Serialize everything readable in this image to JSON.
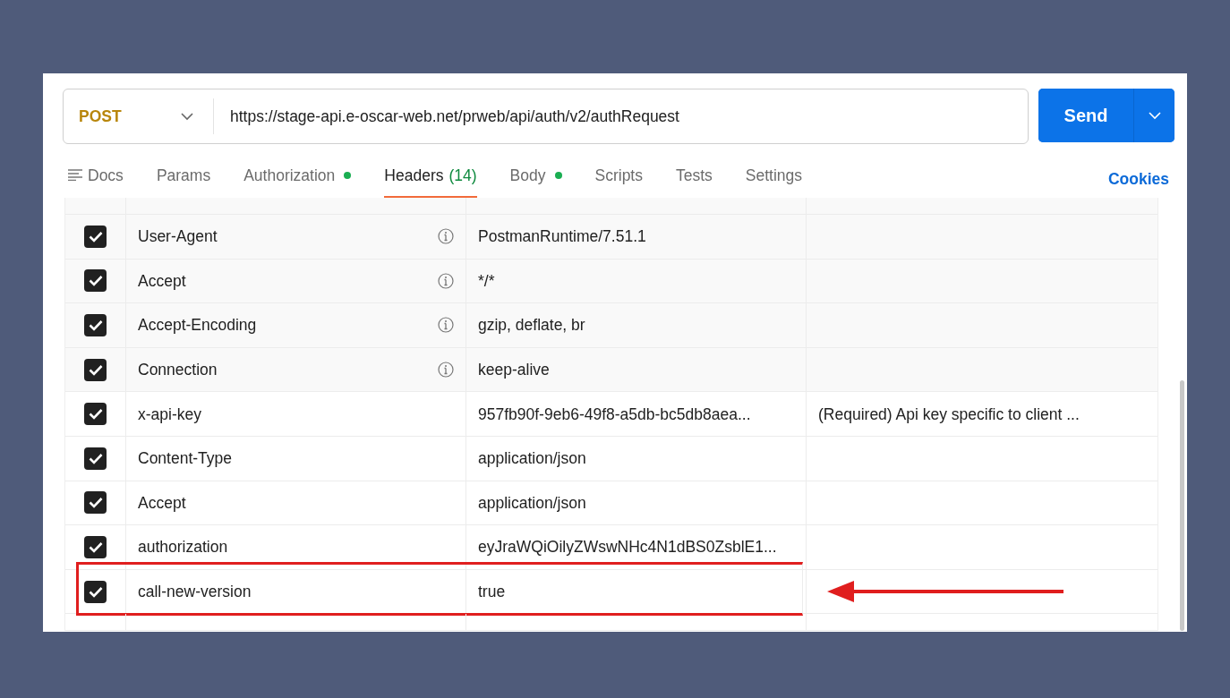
{
  "request": {
    "method": "POST",
    "url": "https://stage-api.e-oscar-web.net/prweb/api/auth/v2/authRequest",
    "send_label": "Send"
  },
  "tabs": [
    {
      "label": "Docs",
      "dot": false,
      "selected": false,
      "kind": "docs"
    },
    {
      "label": "Params",
      "dot": false,
      "selected": false,
      "kind": "plain"
    },
    {
      "label": "Authorization",
      "dot": true,
      "selected": false,
      "kind": "plain"
    },
    {
      "label": "Headers",
      "count": "(14)",
      "dot": false,
      "selected": true,
      "kind": "plain"
    },
    {
      "label": "Body",
      "dot": true,
      "selected": false,
      "kind": "plain"
    },
    {
      "label": "Scripts",
      "dot": false,
      "selected": false,
      "kind": "plain"
    },
    {
      "label": "Tests",
      "dot": false,
      "selected": false,
      "kind": "plain"
    },
    {
      "label": "Settings",
      "dot": false,
      "selected": false,
      "kind": "plain"
    }
  ],
  "cookies_link": "Cookies",
  "headers": [
    {
      "key": "User-Agent",
      "value": "PostmanRuntime/7.51.1",
      "checked": true,
      "kind": "auto",
      "highlighted": false
    },
    {
      "key": "Accept",
      "value": "*/*",
      "checked": true,
      "kind": "auto",
      "highlighted": false
    },
    {
      "key": "Accept-Encoding",
      "value": "gzip, deflate, br",
      "checked": true,
      "kind": "auto",
      "highlighted": false
    },
    {
      "key": "Connection",
      "value": "keep-alive",
      "checked": true,
      "kind": "auto",
      "highlighted": false
    },
    {
      "key": "x-api-key",
      "value": "957fb90f-9eb6-49f8-a5db-bc5db8aea...",
      "description": "(Required) Api key specific to client ...",
      "checked": true,
      "kind": "custom",
      "highlighted": false
    },
    {
      "key": "Content-Type",
      "value": "application/json",
      "checked": true,
      "kind": "custom",
      "highlighted": false
    },
    {
      "key": "Accept",
      "value": "application/json",
      "checked": true,
      "kind": "custom",
      "highlighted": false
    },
    {
      "key": "authorization",
      "value": "eyJraWQiOilyZWswNHc4N1dBS0ZsblE1...",
      "checked": true,
      "kind": "custom",
      "highlighted": false
    },
    {
      "key": "call-new-version",
      "value": "true",
      "checked": true,
      "kind": "custom",
      "highlighted": true
    }
  ]
}
